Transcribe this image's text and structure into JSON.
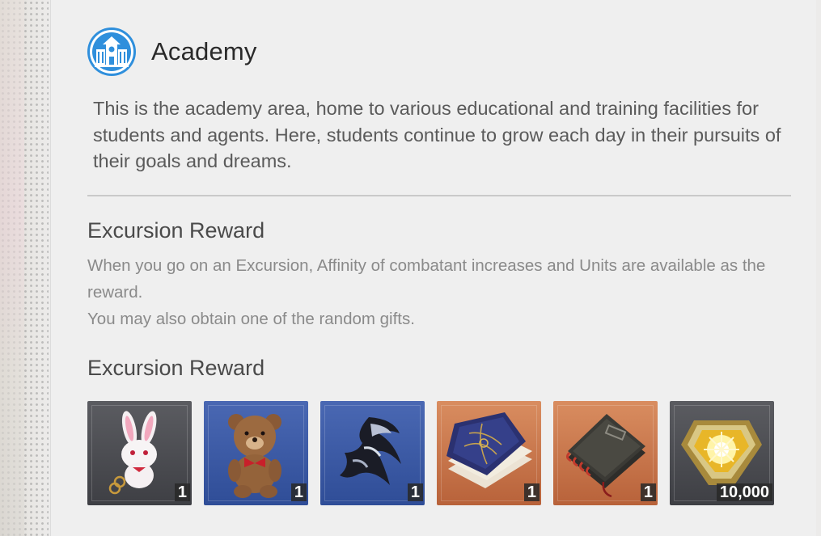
{
  "header": {
    "title": "Academy",
    "icon": "academy-building-icon",
    "icon_color": "#2f8fdc"
  },
  "description": "This is the academy area, home to various educational and training facilities for students and agents. Here, students continue to grow each day in their pursuits of their goals and dreams.",
  "section1": {
    "title": "Excursion Reward",
    "lines": [
      "When you go on an Excursion, Affinity of combatant increases and Units are available as the reward.",
      "You may also obtain one of the random gifts."
    ]
  },
  "section2": {
    "title": "Excursion Reward",
    "items": [
      {
        "icon": "bunny-keychain-icon",
        "quantity": "1",
        "frame": "grey"
      },
      {
        "icon": "teddy-bear-icon",
        "quantity": "1",
        "frame": "blue"
      },
      {
        "icon": "dark-mask-icon",
        "quantity": "1",
        "frame": "blue"
      },
      {
        "icon": "blue-book-icon",
        "quantity": "1",
        "frame": "orange"
      },
      {
        "icon": "notebook-icon",
        "quantity": "1",
        "frame": "orange"
      },
      {
        "icon": "units-crystal-icon",
        "quantity": "10,000",
        "frame": "grey"
      }
    ]
  }
}
